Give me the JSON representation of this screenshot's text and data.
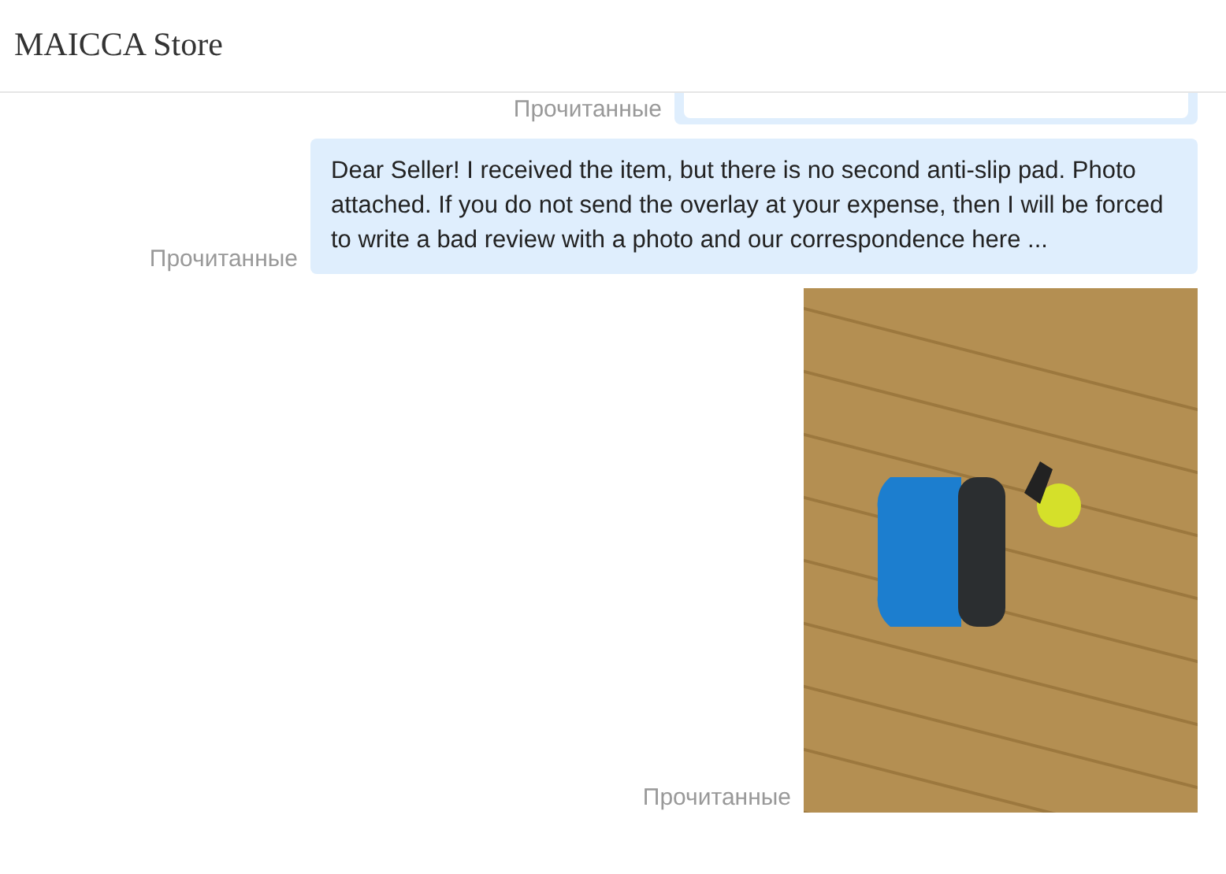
{
  "header": {
    "title": "MAICCA Store"
  },
  "messages": [
    {
      "kind": "attachment",
      "status": "Прочитанные"
    },
    {
      "kind": "text",
      "status": "Прочитанные",
      "text": "Dear Seller! I received the item, but there is no second anti-slip pad. Photo attached. If you do not send the overlay at your expense, then I will be forced to write a bad review with a photo and our correspondence here ..."
    },
    {
      "kind": "photo",
      "status": "Прочитанные"
    }
  ]
}
